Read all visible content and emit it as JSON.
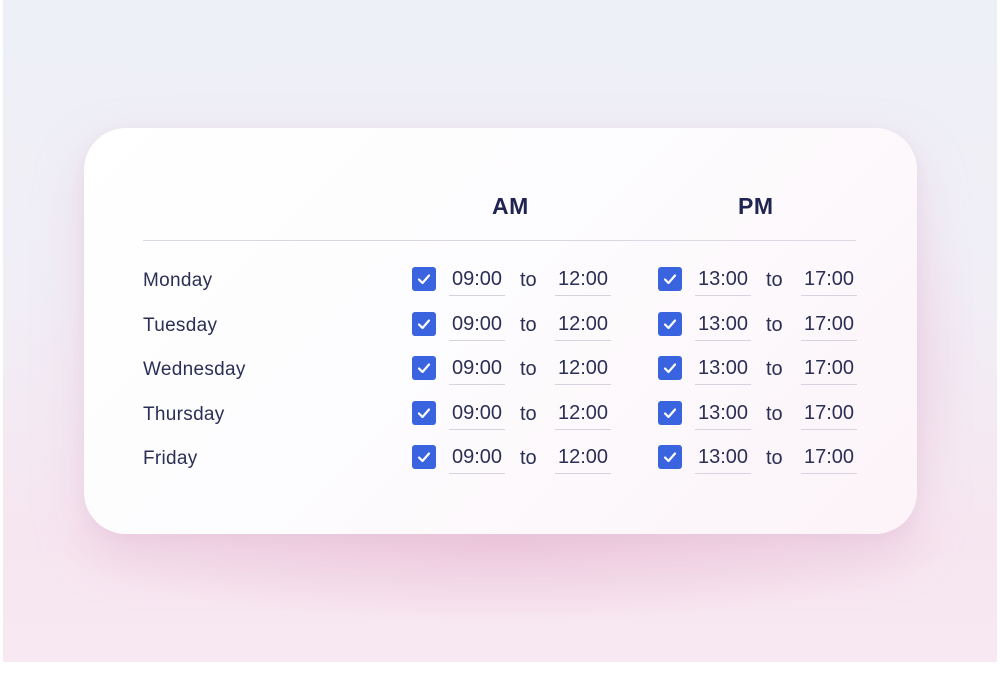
{
  "columns": {
    "am": "AM",
    "pm": "PM"
  },
  "connector": "to",
  "accent": "#3a64df",
  "check_icon": "check-icon",
  "schedule": [
    {
      "day": "Monday",
      "am": {
        "enabled": true,
        "start": "09:00",
        "end": "12:00"
      },
      "pm": {
        "enabled": true,
        "start": "13:00",
        "end": "17:00"
      }
    },
    {
      "day": "Tuesday",
      "am": {
        "enabled": true,
        "start": "09:00",
        "end": "12:00"
      },
      "pm": {
        "enabled": true,
        "start": "13:00",
        "end": "17:00"
      }
    },
    {
      "day": "Wednesday",
      "am": {
        "enabled": true,
        "start": "09:00",
        "end": "12:00"
      },
      "pm": {
        "enabled": true,
        "start": "13:00",
        "end": "17:00"
      }
    },
    {
      "day": "Thursday",
      "am": {
        "enabled": true,
        "start": "09:00",
        "end": "12:00"
      },
      "pm": {
        "enabled": true,
        "start": "13:00",
        "end": "17:00"
      }
    },
    {
      "day": "Friday",
      "am": {
        "enabled": true,
        "start": "09:00",
        "end": "12:00"
      },
      "pm": {
        "enabled": true,
        "start": "13:00",
        "end": "17:00"
      }
    }
  ]
}
